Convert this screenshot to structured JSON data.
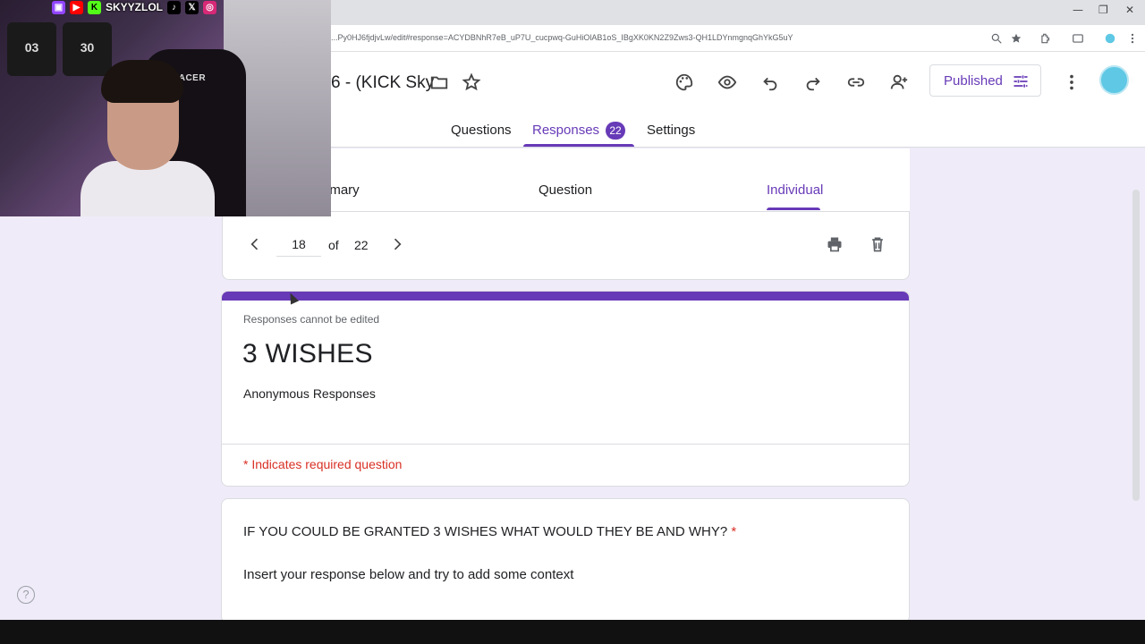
{
  "browser": {
    "url": "...Py0HJ6fjdjvLw/edit#response=ACYDBNhR7eB_uP7U_cucpwq-GuHiOlAB1oS_IBgXK0KN2Z9Zws3-QH1LDYnmgnqGhYkG5uY",
    "window_controls": {
      "minimize": "—",
      "restore": "❐",
      "close": "✕"
    }
  },
  "header": {
    "doc_title": "6 -  (KICK Sky",
    "publish_label": "Published",
    "tabs": [
      {
        "label": "Questions"
      },
      {
        "label": "Responses",
        "badge": "22"
      },
      {
        "label": "Settings"
      }
    ]
  },
  "subtabs": [
    {
      "label": "nmary"
    },
    {
      "label": "Question"
    },
    {
      "label": "Individual"
    }
  ],
  "pager": {
    "current": "18",
    "of_label": "of",
    "total": "22"
  },
  "form": {
    "cannot_edit": "Responses cannot be edited",
    "title": "3 WISHES",
    "description": "Anonymous Responses",
    "required_note": "* Indicates required question"
  },
  "question": {
    "title": "IF YOU COULD BE GRANTED 3 WISHES WHAT WOULD THEY BE AND WHY?",
    "required_star": "*",
    "description": "Insert your response below and try to add some context"
  },
  "help_label": "?",
  "overlay": {
    "streamer_name": "SKYYZLOL",
    "chair_brand": "S-RACER",
    "jersey_numbers": [
      "03",
      "30"
    ]
  },
  "colors": {
    "accent": "#673ab7",
    "background": "#f0ebf8",
    "required": "#d93025"
  },
  "icons": [
    "palette-icon",
    "preview-eye-icon",
    "undo-icon",
    "redo-icon",
    "link-icon",
    "add-collaborator-icon",
    "tune-icon",
    "more-vert-icon",
    "folder-icon",
    "star-icon",
    "chevron-left-icon",
    "chevron-right-icon",
    "print-icon",
    "delete-icon"
  ]
}
